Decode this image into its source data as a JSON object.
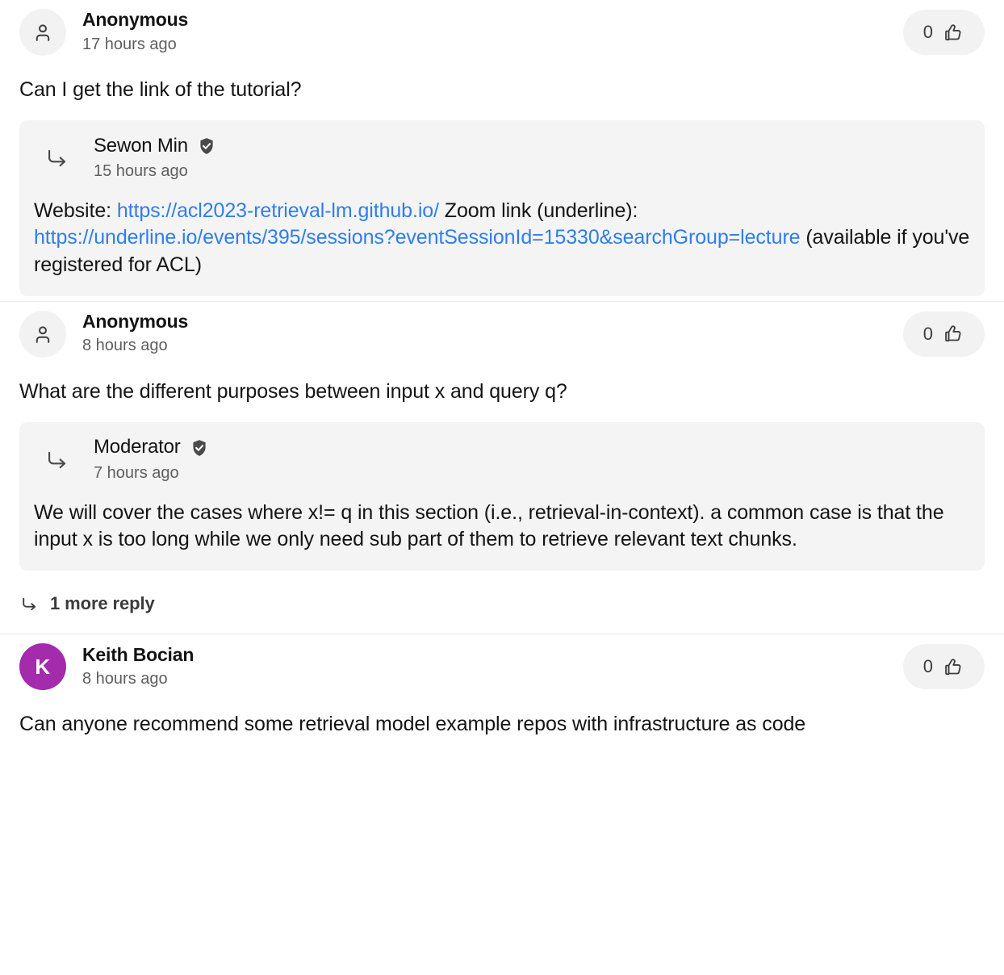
{
  "theme": {
    "page_bg": "#ffffff",
    "card_bg": "#f4f4f4",
    "pill_bg": "#f2f2f2",
    "link_color": "#2f7eea",
    "divider": "#e8e8e8",
    "text": "#141414",
    "muted_text": "#5e5e5e",
    "verified_badge": "#4a4a4a"
  },
  "comments": [
    {
      "author": "Anonymous",
      "avatar_type": "anonymous-icon",
      "timestamp": "17 hours ago",
      "like_count": "0",
      "like_icon": "thumbs-up-icon",
      "body": "Can I get the link of the tutorial?",
      "reply": {
        "arrow_icon": "reply-arrow-icon",
        "author": "Sewon Min",
        "verified": true,
        "verified_icon": "verified-shield-icon",
        "timestamp": "15 hours ago",
        "body_prefix": "Website: ",
        "link1_text": "https://acl2023-retrieval-lm.github.io/",
        "body_middle": " Zoom link (underline): ",
        "link2_text": "https://underline.io/events/395/sessions?eventSessionId=15330&searchGroup=lecture",
        "body_suffix": " (available if you've registered for ACL)"
      }
    },
    {
      "author": "Anonymous",
      "avatar_type": "anonymous-icon",
      "timestamp": "8 hours ago",
      "like_count": "0",
      "like_icon": "thumbs-up-icon",
      "body": "What are the different purposes between input x and query q?",
      "reply": {
        "arrow_icon": "reply-arrow-icon",
        "author": "Moderator",
        "verified": true,
        "verified_icon": "verified-shield-icon",
        "timestamp": "7 hours ago",
        "body": "We will cover the cases where x!= q in this section (i.e., retrieval-in-context). a common case is that the input x is too long while we only need sub part of them to retrieve relevant text chunks."
      },
      "more_replies_label": "1 more reply",
      "more_replies_icon": "reply-arrow-icon"
    },
    {
      "author": "Keith Bocian",
      "avatar_type": "letter",
      "avatar_letter": "K",
      "avatar_color": "#a32bac",
      "timestamp": "8 hours ago",
      "like_count": "0",
      "like_icon": "thumbs-up-icon",
      "body": "Can anyone recommend some retrieval model example repos with infrastructure as code"
    }
  ]
}
